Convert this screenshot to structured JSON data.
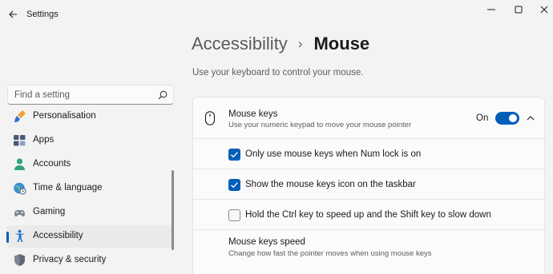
{
  "window": {
    "title": "Settings"
  },
  "search": {
    "placeholder": "Find a setting"
  },
  "sidebar": {
    "items": [
      {
        "label": "Personalisation",
        "icon": "brush-icon"
      },
      {
        "label": "Apps",
        "icon": "apps-icon"
      },
      {
        "label": "Accounts",
        "icon": "person-icon"
      },
      {
        "label": "Time & language",
        "icon": "globe-clock-icon"
      },
      {
        "label": "Gaming",
        "icon": "gamepad-icon"
      },
      {
        "label": "Accessibility",
        "icon": "accessibility-icon",
        "active": true
      },
      {
        "label": "Privacy & security",
        "icon": "shield-icon"
      }
    ]
  },
  "header": {
    "parent": "Accessibility",
    "separator": "›",
    "current": "Mouse",
    "description": "Use your keyboard to control your mouse."
  },
  "mouse_keys": {
    "title": "Mouse keys",
    "description": "Use your numeric keypad to move your mouse pointer",
    "state_label": "On",
    "enabled": true,
    "expanded": true,
    "options": [
      {
        "label": "Only use mouse keys when Num lock is on",
        "checked": true
      },
      {
        "label": "Show the mouse keys icon on the taskbar",
        "checked": true
      },
      {
        "label": "Hold the Ctrl key to speed up and the Shift key to slow down",
        "checked": false
      }
    ],
    "speed": {
      "title": "Mouse keys speed",
      "description": "Change how fast the pointer moves when using mouse keys"
    }
  },
  "colors": {
    "accent": "#005fb8",
    "background": "#f3f3f3",
    "card": "#fbfbfb"
  }
}
